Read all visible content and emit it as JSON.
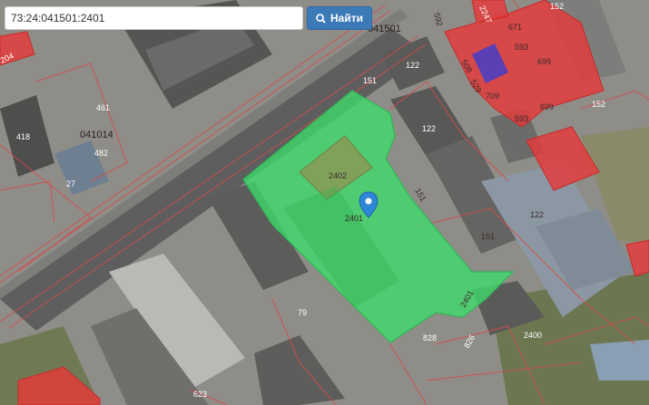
{
  "search": {
    "query": "73:24:041501:2401",
    "button_label": "Найти"
  },
  "map": {
    "quarter_labels": [
      "041501",
      "041014"
    ],
    "parcel_labels": {
      "p2401": "2401",
      "p2402": "2402",
      "p2401b": "2401",
      "p122a": "122",
      "p122b": "122",
      "p122c": "122",
      "p151a": "151",
      "p151b": "151",
      "p151c": "151",
      "p152a": "152",
      "p152b": "152",
      "p593a": "593",
      "p593b": "593",
      "p699a": "699",
      "p699b": "699",
      "p671": "671",
      "p709": "709",
      "p461": "461",
      "p418": "418",
      "p482": "482",
      "p27": "27",
      "p79": "79",
      "p623": "623",
      "p828": "828",
      "p826": "826",
      "p2400": "2400",
      "p204": "204",
      "p508": "508",
      "p529": "529",
      "p592": "592",
      "p2247": "2247"
    },
    "colors": {
      "selected_parcel": "#3ddc6a",
      "red_parcel": "#e53b3b",
      "boundary": "#d84a4a"
    },
    "marker_icon": "map-pin-icon"
  }
}
